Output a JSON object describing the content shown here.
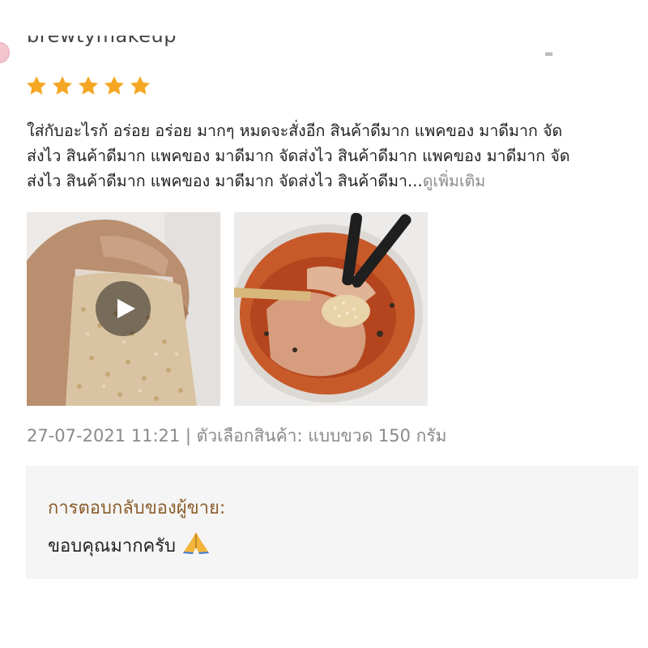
{
  "review": {
    "username": "brewtymakeup",
    "rating": 5,
    "rating_max": 5,
    "star_color": "#f5a623",
    "text": "ใส่กับอะไรก้ อร่อย อร่อย มากๆ หมดจะสั่งอีก สินค้าดีมาก แพคของ มาดีมาก จัด\nส่งไว สินค้าดีมาก แพคของ มาดีมาก จัดส่งไว สินค้าดีมาก แพคของ มาดีมาก จัด\nส่งไว สินค้าดีมาก แพคของ มาดีมาก จัดส่งไว สินค้าดีมา...",
    "see_more": "ดูเพิ่มเติม",
    "media": [
      {
        "kind": "video",
        "icon": "play-icon"
      },
      {
        "kind": "photo"
      }
    ],
    "meta": "27-07-2021 11:21 | ตัวเลือกสินค้า: แบบขวด 150 กรัม"
  },
  "seller_reply": {
    "label": "การตอบกลับของผู้ขาย:",
    "text": "ขอบคุณมากครับ",
    "emoji": "🙏"
  }
}
